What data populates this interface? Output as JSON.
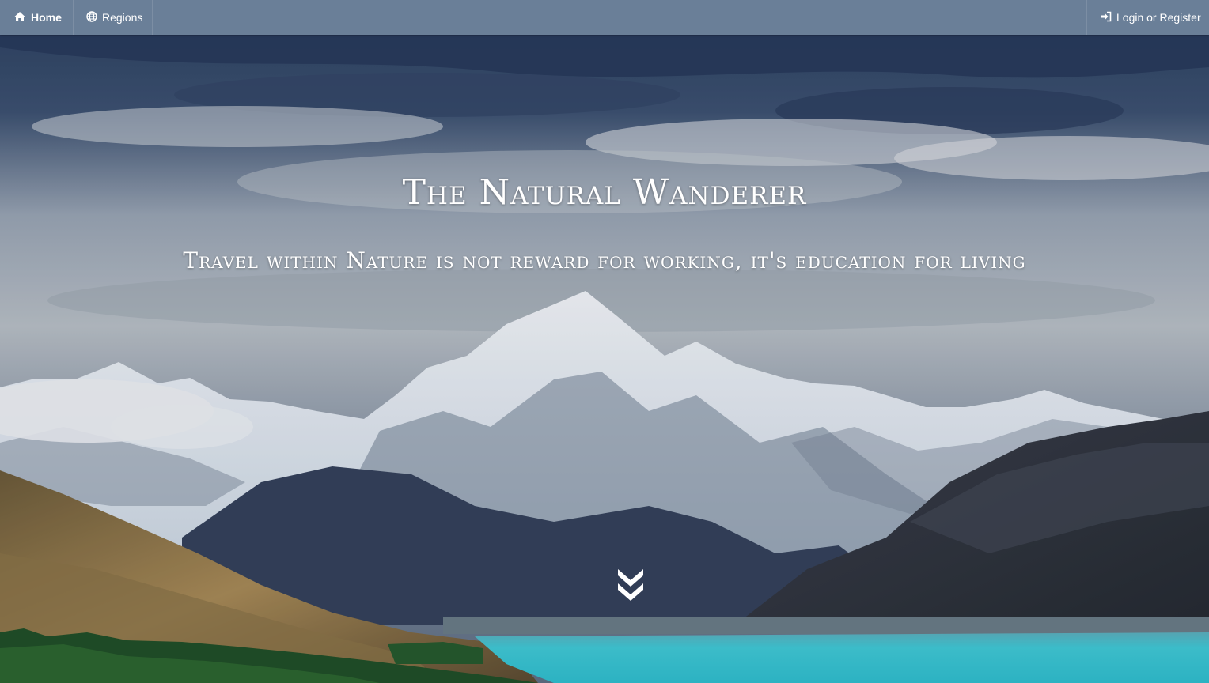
{
  "nav": {
    "home_label": "Home",
    "regions_label": "Regions",
    "login_label": "Login or Register",
    "home_icon": "home-icon",
    "regions_icon": "globe-icon",
    "login_icon": "sign-in-icon"
  },
  "hero": {
    "title": "The Natural Wanderer",
    "subtitle": "Travel within Nature is not reward for working, it's education for living",
    "scroll_icon": "chevron-double-down-icon"
  },
  "colors": {
    "navbar": "#6a7f98",
    "lake": "#3cc6d4",
    "text": "#ffffff"
  }
}
